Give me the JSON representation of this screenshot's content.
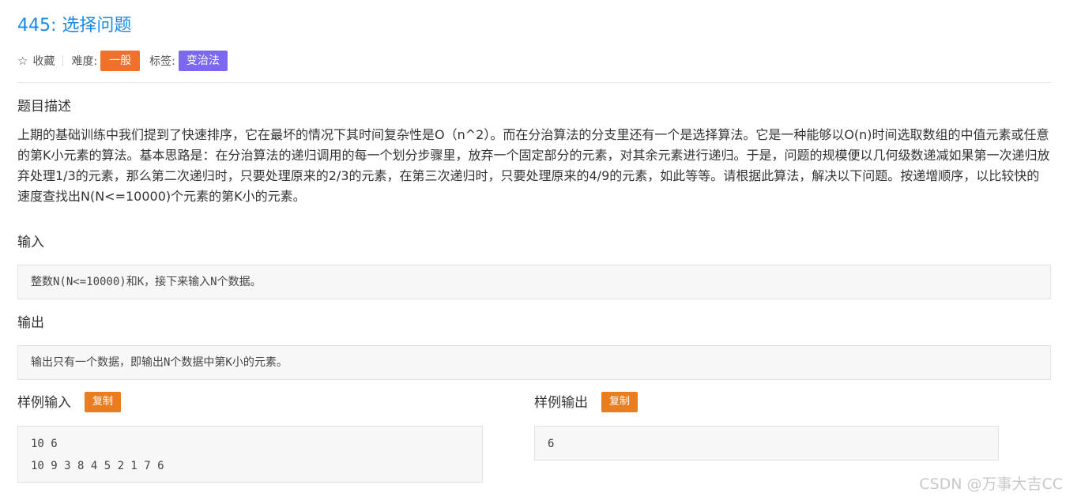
{
  "problem": {
    "title": "445: 选择问题"
  },
  "meta": {
    "favorite_label": "收藏",
    "difficulty_label": "难度:",
    "difficulty_value": "一般",
    "tags_label": "标签:",
    "tag_value": "变治法",
    "colors": {
      "difficulty": "#f0712c",
      "tag": "#7b68ee",
      "title": "#1e88e5"
    }
  },
  "description": {
    "heading": "题目描述",
    "text": "上期的基础训练中我们提到了快速排序，它在最坏的情况下其时间复杂性是O（n^2）。而在分治算法的分支里还有一个是选择算法。它是一种能够以O(n)时间选取数组的中值元素或任意的第K小元素的算法。基本思路是：在分治算法的递归调用的每一个划分步骤里，放弃一个固定部分的元素，对其余元素进行递归。于是，问题的规模便以几何级数递减如果第一次递归放弃处理1/3的元素，那么第二次递归时，只要处理原来的2/3的元素，在第三次递归时，只要处理原来的4/9的元素，如此等等。请根据此算法，解决以下问题。按递增顺序，以比较快的速度查找出N(N<=10000)个元素的第K小的元素。"
  },
  "input": {
    "heading": "输入",
    "text": "整数N(N<=10000)和K，接下来输入N个数据。"
  },
  "output": {
    "heading": "输出",
    "text": "输出只有一个数据，即输出N个数据中第K小的元素。"
  },
  "sample_input": {
    "heading": "样例输入",
    "copy_label": "复制",
    "lines": [
      "10 6",
      "10 9 3 8 4 5 2 1 7 6"
    ]
  },
  "sample_output": {
    "heading": "样例输出",
    "copy_label": "复制",
    "lines": [
      "6"
    ]
  },
  "watermark": "CSDN @万事大吉CC"
}
